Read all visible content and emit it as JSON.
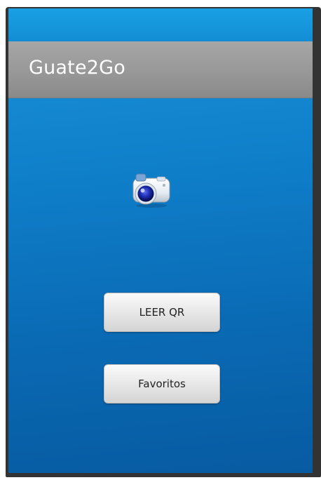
{
  "app": {
    "title": "Guate2Go"
  },
  "main": {
    "camera_icon": "camera-icon",
    "read_qr_label": "LEER QR",
    "favorites_label": "Favoritos"
  },
  "colors": {
    "screen_background": "#0f7fca",
    "title_bar": "#989898",
    "status_bar": "#138dd4",
    "button_face": "#e9e9e9",
    "frame": "#333333"
  }
}
